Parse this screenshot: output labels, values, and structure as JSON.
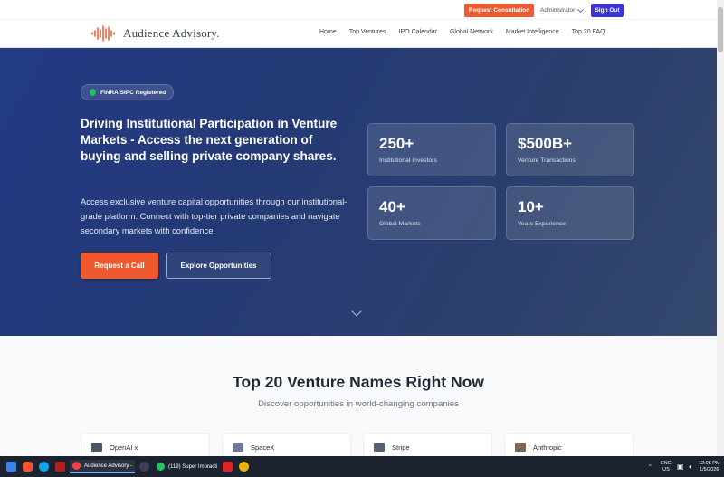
{
  "topbar": {
    "consult_label": "Request Consultation",
    "admin_label": "Administrator",
    "signout_label": "Sign Out"
  },
  "nav": {
    "brand": "Audience Advisory.",
    "items": [
      "Home",
      "Top Ventures",
      "IPO Calendar",
      "Global Network",
      "Market Intelligence",
      "Top 20 FAQ"
    ]
  },
  "hero": {
    "badge": "FINRA/SIPC Registered",
    "headline": "Driving Institutional Participation in Venture Markets - Access the next generation of buying and selling private company shares.",
    "lead": "Access exclusive venture capital opportunities through our institutional-grade platform. Connect with top-tier private companies and navigate secondary markets with confidence.",
    "cta_primary": "Request a Call",
    "cta_secondary": "Explore Opportunities",
    "stats": [
      {
        "value": "250+",
        "label": "Institutional Investors"
      },
      {
        "value": "$500B+",
        "label": "Venture Transactions"
      },
      {
        "value": "40+",
        "label": "Global Markets"
      },
      {
        "value": "10+",
        "label": "Years Experience"
      }
    ]
  },
  "section": {
    "title": "Top 20 Venture Names Right Now",
    "subtitle": "Discover opportunities in world-changing companies",
    "cards": [
      "OpenAI x",
      "SpaceX",
      "Stripe",
      "Anthropic"
    ]
  },
  "taskbar": {
    "tasks": [
      "Audience Advisory -",
      "(119) Super Impracti"
    ],
    "lang_top": "ENG",
    "lang_bottom": "US",
    "time": "12:05 PM",
    "date": "1/5/2026"
  },
  "colors": {
    "accent": "#f0592d",
    "signout": "#3b35d6",
    "hero_start": "#233a86",
    "hero_end": "#34496d"
  }
}
